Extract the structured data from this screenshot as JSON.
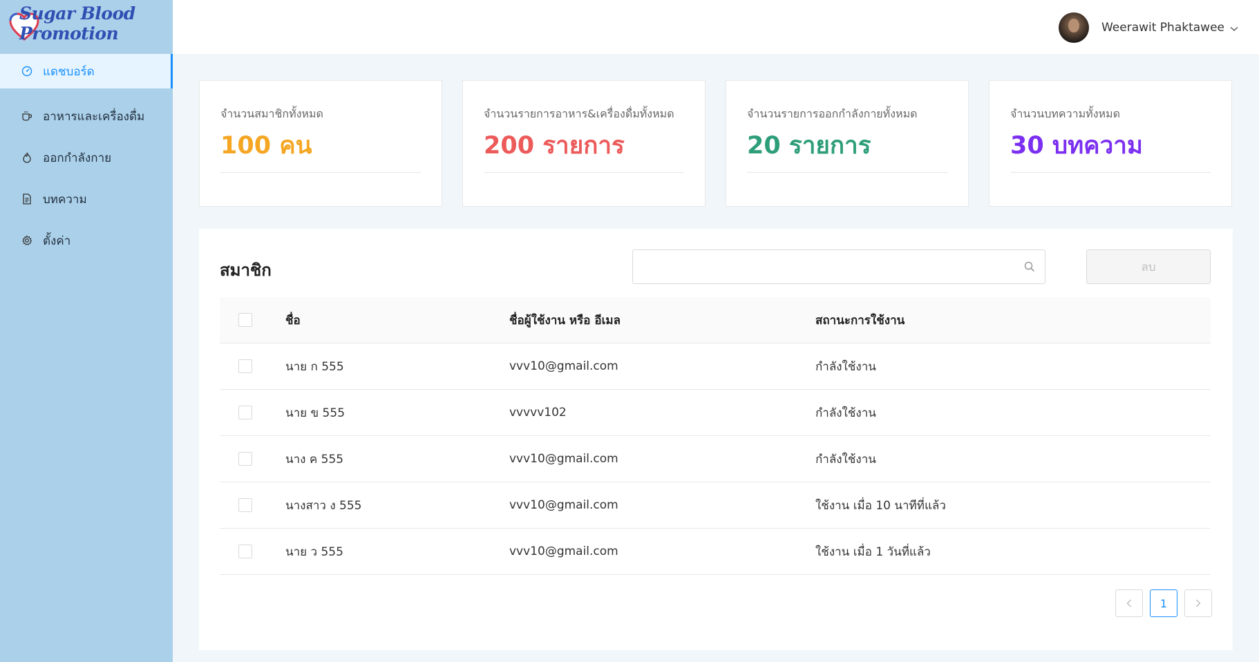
{
  "app": {
    "logo_text": "Sugar Blood Promotion"
  },
  "sidebar": {
    "items": [
      {
        "label": "แดชบอร์ด",
        "icon": "dashboard-icon",
        "active": true
      },
      {
        "label": "อาหารและเครื่องดื่ม",
        "icon": "cup-icon"
      },
      {
        "label": "ออกกำลังกาย",
        "icon": "flame-icon"
      },
      {
        "label": "บทความ",
        "icon": "document-icon"
      },
      {
        "label": "ตั้งค่า",
        "icon": "gear-icon"
      }
    ]
  },
  "header": {
    "user_name": "Weerawit Phaktawee"
  },
  "stats": [
    {
      "label": "จำนวนสมาชิกทั้งหมด",
      "value": "100 คน",
      "color": "#f5a623"
    },
    {
      "label": "จำนวนรายการอาหาร&เครื่องดื่มทั้งหมด",
      "value": "200 รายการ",
      "color": "#ec5a5a"
    },
    {
      "label": "จำนวนรายการออกกำลังกายทั้งหมด",
      "value": "20 รายการ",
      "color": "#2e9e7a"
    },
    {
      "label": "จำนวนบทความทั้งหมด",
      "value": "30 บทความ",
      "color": "#7b2ff0"
    }
  ],
  "members": {
    "title": "สมาชิก",
    "search_placeholder": "",
    "delete_label": "ลบ",
    "columns": {
      "name": "ชื่อ",
      "username": "ชื่อผู้ใช้งาน หรือ อีเมล",
      "status": "สถานะการใช้งาน"
    },
    "rows": [
      {
        "name": "นาย ก 555",
        "username": "vvv10@gmail.com",
        "status": "กำลังใช้งาน"
      },
      {
        "name": "นาย ข 555",
        "username": "vvvvv102",
        "status": "กำลังใช้งาน"
      },
      {
        "name": "นาง ค 555",
        "username": "vvv10@gmail.com",
        "status": "กำลังใช้งาน"
      },
      {
        "name": "นางสาว ง 555",
        "username": "vvv10@gmail.com",
        "status": "ใช้งาน เมื่อ 10 นาทีที่แล้ว"
      },
      {
        "name": "นาย ว 555",
        "username": "vvv10@gmail.com",
        "status": "ใช้งาน เมื่อ 1 วันที่แล้ว"
      }
    ],
    "pagination": {
      "current_page": "1"
    }
  }
}
